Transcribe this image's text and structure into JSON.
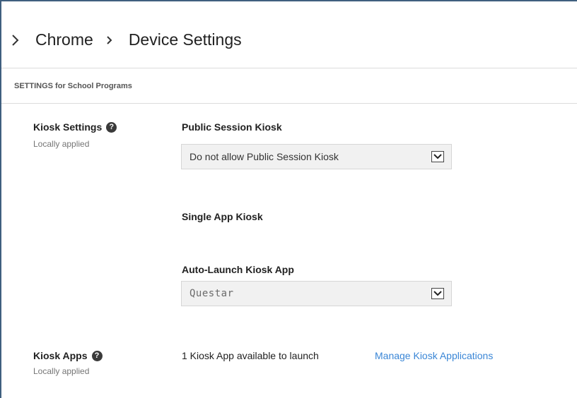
{
  "breadcrumb": {
    "items": [
      "Chrome",
      "Device Settings"
    ]
  },
  "section": {
    "header": "SETTINGS for School Programs"
  },
  "kiosk_settings": {
    "title": "Kiosk Settings",
    "subtitle": "Locally applied",
    "public_session": {
      "label": "Public Session Kiosk",
      "selected": "Do not allow Public Session Kiosk"
    },
    "single_app": {
      "label": "Single App Kiosk"
    },
    "auto_launch": {
      "label": "Auto-Launch Kiosk App",
      "selected": "Questar"
    }
  },
  "kiosk_apps": {
    "title": "Kiosk Apps",
    "subtitle": "Locally applied",
    "status": "1 Kiosk App available to launch",
    "manage_link": "Manage Kiosk Applications"
  },
  "icons": {
    "breadcrumb_chevron": "chevron-right-icon",
    "help": "help-icon",
    "dropdown": "chevron-down-icon"
  },
  "colors": {
    "link": "#3a86d6",
    "frame": "#3f5f7f",
    "select_bg": "#f1f1f1"
  }
}
